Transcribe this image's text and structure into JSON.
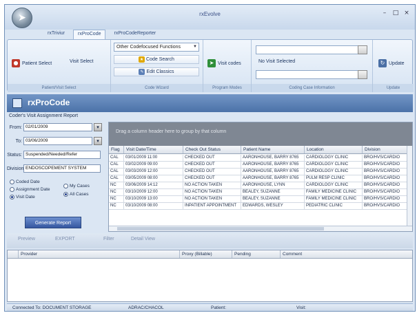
{
  "window": {
    "title": "rxEvolve"
  },
  "ribbon": {
    "tabs": [
      {
        "label": "rxTriviur"
      },
      {
        "label": "rxProCode"
      },
      {
        "label": "rxProCodeReporter"
      }
    ],
    "groups": {
      "patient_visit_select": {
        "label": "Patient/Visit Select",
        "patient_select": "Patient Select",
        "visit_select": "Visit Select"
      },
      "code_wizard": {
        "label": "Code Wizard",
        "dropdown_value": "Other Codefocused Functions",
        "code_search": "Code Search",
        "edit_classics": "Edit Classics"
      },
      "program_modes": {
        "label": "Program Modes",
        "visit_codes": "Visit codes"
      },
      "coding_case_information": {
        "label": "Coding Case Information",
        "field_label": "No Visit Selected"
      },
      "update": {
        "label": "Update",
        "update_button": "Update"
      }
    }
  },
  "app_header": {
    "title": "rxProCode"
  },
  "subtitle": "Coder's Visit Assignment Report",
  "filters": {
    "from_label": "From:",
    "from_value": "02/01/2009",
    "to_label": "To:",
    "to_value": "03/06/2009",
    "status_label": "Status:",
    "status_value": "Suspended/Needed/Refer",
    "division_label": "Division:",
    "division_value": "ENDOSCOPEMENT SYSTEM",
    "radios": [
      {
        "label": "Coded Date",
        "selected": false
      },
      {
        "label": "My Cases",
        "selected": false
      },
      {
        "label": "Assignment Date",
        "selected": false
      },
      {
        "label": "All Cases",
        "selected": true
      },
      {
        "label": "Visit Date",
        "selected": true
      }
    ],
    "generate_button": "Generate Report"
  },
  "grid": {
    "group_hint": "Drag a column header here to group by that column",
    "columns": [
      "Flag",
      "Visit Date/Time",
      "Check Out Status",
      "Patient Name",
      "Location",
      "Division"
    ],
    "rows": [
      [
        "CAL",
        "03/01/2009 11:00",
        "CHECKED OUT",
        "AARONHOUSE, BARRY 8765",
        "CARDIOLOGY CLINIC",
        "BRO/HVS/CARDIO"
      ],
      [
        "CAL",
        "03/02/2009 09:00",
        "CHECKED OUT",
        "AARONHOUSE, BARRY 8765",
        "CARDIOLOGY CLINIC",
        "BRO/HVS/CARDIO"
      ],
      [
        "CAL",
        "03/03/2009 12:00",
        "CHECKED OUT",
        "AARONHOUSE, BARRY 8765",
        "CARDIOLOGY CLINIC",
        "BRO/HVS/CARDIO"
      ],
      [
        "CAL",
        "03/05/2009 08:00",
        "CHECKED OUT",
        "AARONHOUSE, BARRY 8765",
        "PULM RESP CLINIC",
        "BRO/HVS/CARDIO"
      ],
      [
        "NC",
        "03/06/2009 14:12",
        "NO ACTION TAKEN",
        "AARONHOUSE, LYNN",
        "CARDIOLOGY CLINIC",
        "BRO/HVS/CARDIO"
      ],
      [
        "NC",
        "03/10/2009 12:00",
        "NO ACTION TAKEN",
        "BEALEY, SUZANNE",
        "FAMILY MEDICINE CLINIC",
        "BRO/HVS/CARDIO"
      ],
      [
        "NC",
        "03/10/2009 13:00",
        "NO ACTION TAKEN",
        "BEALEY, SUZANNE",
        "FAMILY MEDICINE CLINIC",
        "BRO/HVS/CARDIO"
      ],
      [
        "NC",
        "03/10/2009 08:00",
        "INPATIENT APPOINTMENT",
        "EDWARDS, WESLEY",
        "PEDIATRIC CLINIC",
        "BRO/HVS/CARDIO"
      ]
    ]
  },
  "toolbar": {
    "preview": "Preview",
    "export": "EXPORT",
    "filter": "Filter",
    "detail_view": "Detail View"
  },
  "bottom_grid": {
    "columns": [
      "Provider",
      "Proxy (Billable)",
      "Pending",
      "Comment"
    ]
  },
  "status_bar": {
    "connected": "Connected To: DOCUMENT STORAGE",
    "user": "ADRAC/CHACOL",
    "patient": "Patient:",
    "visit": "Visit:"
  }
}
